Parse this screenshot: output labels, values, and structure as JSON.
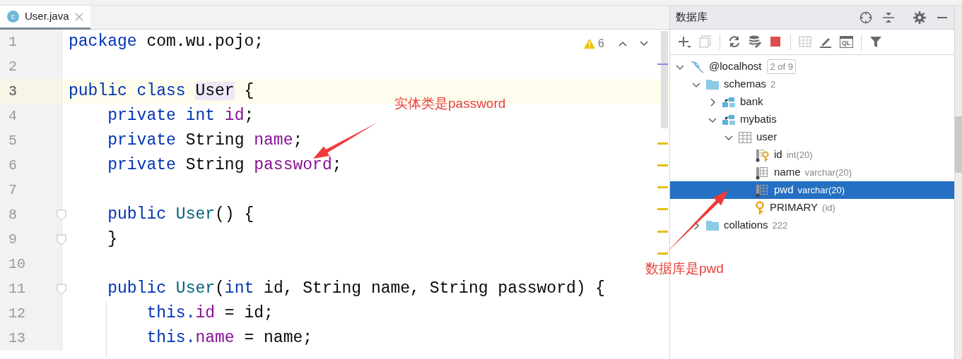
{
  "editor": {
    "tabs": [
      {
        "label": "User.java",
        "icon_text": "c",
        "selected": true
      }
    ],
    "inspection": {
      "count": "6"
    },
    "lines": [
      {
        "number": "1",
        "current": false,
        "fold": false,
        "tokens": [
          {
            "kind": "keyword",
            "text": "package"
          },
          {
            "kind": "plain",
            "text": " com.wu.pojo;"
          }
        ]
      },
      {
        "number": "2",
        "current": false,
        "fold": false
      },
      {
        "number": "3",
        "current": true,
        "fold": false,
        "tokens": [
          {
            "kind": "keyword",
            "text": "public class "
          },
          {
            "kind": "highlight",
            "text": "User"
          },
          {
            "kind": "plain",
            "text": " {"
          }
        ]
      },
      {
        "number": "4",
        "current": false,
        "fold": false,
        "tokens": [
          {
            "kind": "keyword",
            "text": "    private int "
          },
          {
            "kind": "field",
            "text": "id"
          },
          {
            "kind": "plain",
            "text": ";"
          }
        ]
      },
      {
        "number": "5",
        "current": false,
        "fold": false,
        "tokens": [
          {
            "kind": "keyword",
            "text": "    private "
          },
          {
            "kind": "plain",
            "text": "String "
          },
          {
            "kind": "field",
            "text": "name"
          },
          {
            "kind": "plain",
            "text": ";"
          }
        ]
      },
      {
        "number": "6",
        "current": false,
        "fold": false,
        "tokens": [
          {
            "kind": "keyword",
            "text": "    private "
          },
          {
            "kind": "plain",
            "text": "String "
          },
          {
            "kind": "field",
            "text": "password"
          },
          {
            "kind": "plain",
            "text": ";"
          }
        ]
      },
      {
        "number": "7",
        "current": false,
        "fold": false
      },
      {
        "number": "8",
        "current": false,
        "fold": true,
        "tokens": [
          {
            "kind": "keyword",
            "text": "    public "
          },
          {
            "kind": "method",
            "text": "User"
          },
          {
            "kind": "plain",
            "text": "() {"
          }
        ]
      },
      {
        "number": "9",
        "current": false,
        "fold": true,
        "tokens": [
          {
            "kind": "plain",
            "text": "    }"
          }
        ]
      },
      {
        "number": "10",
        "current": false,
        "fold": false
      },
      {
        "number": "11",
        "current": false,
        "fold": true,
        "tokens": [
          {
            "kind": "keyword",
            "text": "    public "
          },
          {
            "kind": "method",
            "text": "User"
          },
          {
            "kind": "plain",
            "text": "("
          },
          {
            "kind": "keyword",
            "text": "int "
          },
          {
            "kind": "plain",
            "text": "id, String name, String password) {"
          }
        ]
      },
      {
        "number": "12",
        "current": false,
        "fold": false,
        "tokens": [
          {
            "kind": "keyword",
            "text": "        this."
          },
          {
            "kind": "field",
            "text": "id"
          },
          {
            "kind": "plain",
            "text": " = id;"
          }
        ]
      },
      {
        "number": "13",
        "current": false,
        "fold": false,
        "tokens": [
          {
            "kind": "keyword",
            "text": "        this."
          },
          {
            "kind": "field",
            "text": "name"
          },
          {
            "kind": "plain",
            "text": " = name;"
          }
        ]
      }
    ]
  },
  "database": {
    "title": "数据库",
    "toolbar": [
      {
        "kind": "add",
        "disabled": false
      },
      {
        "kind": "copy",
        "disabled": true
      },
      {
        "kind": "separator"
      },
      {
        "kind": "refresh",
        "disabled": false
      },
      {
        "kind": "tools",
        "disabled": false
      },
      {
        "kind": "stop",
        "disabled": false
      },
      {
        "kind": "separator"
      },
      {
        "kind": "table",
        "disabled": true
      },
      {
        "kind": "edit",
        "disabled": false
      },
      {
        "kind": "console",
        "label": "QL",
        "disabled": false
      },
      {
        "kind": "separator"
      },
      {
        "kind": "filter",
        "disabled": false
      }
    ],
    "tree": [
      {
        "kind": "host",
        "label": "@localhost",
        "badge": "2 of 9",
        "expanded": true,
        "selected": false,
        "children": [
          {
            "kind": "folder",
            "label": "schemas",
            "detail": "2",
            "expanded": true,
            "selected": false,
            "children": [
              {
                "kind": "schema",
                "label": "bank",
                "expanded": false,
                "selected": false
              },
              {
                "kind": "schema",
                "label": "mybatis",
                "expanded": true,
                "selected": false,
                "children": [
                  {
                    "kind": "table",
                    "label": "user",
                    "expanded": true,
                    "selected": false,
                    "children": [
                      {
                        "kind": "key_column",
                        "label": "id",
                        "detail": "int(20)",
                        "selected": false
                      },
                      {
                        "kind": "column",
                        "label": "name",
                        "detail": "varchar(20)",
                        "selected": false
                      },
                      {
                        "kind": "column",
                        "label": "pwd",
                        "detail": "varchar(20)",
                        "selected": true
                      },
                      {
                        "kind": "key",
                        "label": "PRIMARY",
                        "detail": "(id)",
                        "selected": false
                      }
                    ]
                  }
                ]
              }
            ]
          },
          {
            "kind": "folder",
            "label": "collations",
            "detail": "222",
            "expanded": false,
            "selected": false
          }
        ]
      }
    ]
  },
  "annotations": [
    {
      "text": "实体类是password"
    },
    {
      "text": "数据库是pwd"
    }
  ]
}
